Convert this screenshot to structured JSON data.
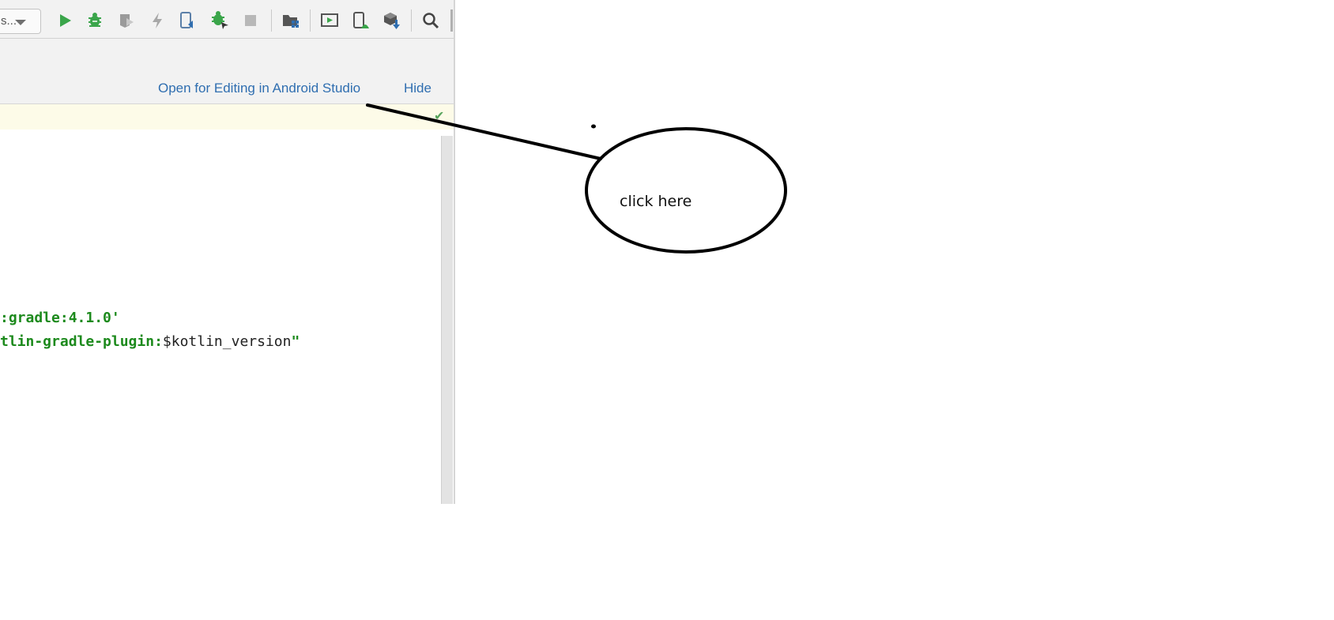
{
  "toolbar": {
    "config_combo_text": "s...",
    "buttons": [
      {
        "icon": "run-icon",
        "color": "#3aa54a"
      },
      {
        "icon": "debug-icon",
        "color": "#3aa54a"
      },
      {
        "icon": "coverage-icon",
        "color": "#9a9a9a"
      },
      {
        "icon": "apply-changes-icon",
        "color": "#a8a8a8"
      },
      {
        "icon": "apply-code-changes-icon",
        "color": "#5b7fa8"
      },
      {
        "icon": "attach-debugger-icon",
        "color": "#3aa54a"
      },
      {
        "icon": "stop-icon",
        "color": "#b8b8b8"
      },
      {
        "icon": "project-structure-icon",
        "color": "#5b7fa8"
      },
      {
        "icon": "avd-manager-icon",
        "color": "#555555"
      },
      {
        "icon": "device-manager-icon",
        "color": "#3aa54a"
      },
      {
        "icon": "sdk-manager-icon",
        "color": "#2f6eb0"
      },
      {
        "icon": "search-icon",
        "color": "#555555"
      }
    ]
  },
  "notification": {
    "open_label": "Open for Editing in Android Studio",
    "hide_label": "Hide",
    "link_color": "#2f6eb0"
  },
  "editor": {
    "line1_str": ":gradle:4.1.0'",
    "line2_str": "tlin-gradle-plugin:",
    "line2_var": "$kotlin_version",
    "line2_end": "\""
  },
  "annotation": {
    "callout_text": "click here"
  }
}
